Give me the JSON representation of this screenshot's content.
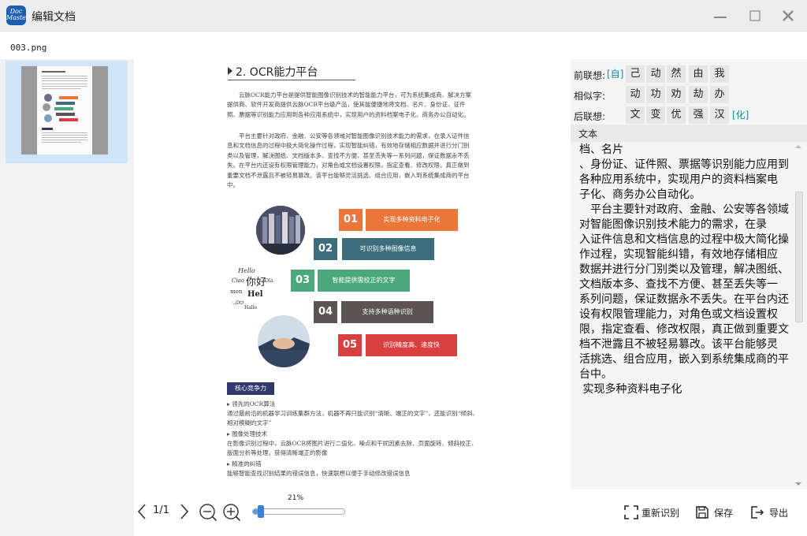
{
  "window": {
    "title": "编辑文档",
    "logo_text": "Doc Master"
  },
  "file": {
    "name": "003.png"
  },
  "document": {
    "heading": "2. OCR能力平台",
    "p1": "云脉OCR能力平台是提供智能图像识别技术的智能能力平台，可为系统集成商、解决方案提供商、软件开发商提供云脉OCR平台级产品，使其能便捷地将文档、名片、身份证、证件照、票据等识别能力应用到各种应用系统中，实现用户的资料档案电子化、商务办公自动化。",
    "p2": "平台主要针对政府、金融、公安等各领域对智能图像识别技术能力的需求，在录入证件信息和文档信息的过程中极大简化操作过程，实现智能纠错，有效地存储相应数据并进行分门别类以及管理，解决图纸、文档版本多、查找不方便、甚至丢失等一系列问题，保证数据永不丢失。在平台内还设有权限管理能力，对角色或文档设置权限，指定查看、修改权限，真正做到重要文档不泄露且不被轻易篡改。该平台能够灵活挑选、组合应用，嵌入到系统集成商的平台中。",
    "items": [
      {
        "num": "01",
        "label": "实现多种资料电子化",
        "color": "#e9773a"
      },
      {
        "num": "02",
        "label": "可识别多种图像信息",
        "color": "#3b6d7c"
      },
      {
        "num": "03",
        "label": "智能提供需校正的文字",
        "color": "#4aa87c"
      },
      {
        "num": "04",
        "label": "支持多种语种识别",
        "color": "#5a5552"
      },
      {
        "num": "05",
        "label": "识别精度高、速度快",
        "color": "#d8403f"
      }
    ],
    "section_label": "核心竞争力",
    "features": [
      {
        "title": "领先的OCR算法",
        "desc": "通过最前沿的机器学习训练集群方法，机器不再只能识别“清晰、端正的文字”，还能识别“倾斜、相对模糊的文字”"
      },
      {
        "title": "图像处理技术",
        "desc": "在影像识别过程中，云脉OCR将图片进行二值化、噪点和干扰因素去除、页面旋转、倾斜校正、版面分析等处理，获得清晰端正的影像"
      },
      {
        "title": "精准的纠错",
        "desc": "能够智能查找识别结果的错误信息，快速联想以便于手动修改错误信息"
      }
    ]
  },
  "associations": {
    "prev_label": "前联想:",
    "prev_bracket": "[自]",
    "prev_chars": [
      "己",
      "动",
      "然",
      "由",
      "我"
    ],
    "similar_label": "相似字:",
    "similar_chars": [
      "动",
      "功",
      "劝",
      "劫",
      "办"
    ],
    "next_label": "后联想:",
    "next_chars": [
      "文",
      "变",
      "优",
      "强",
      "汉"
    ],
    "next_bracket": "[化]"
  },
  "text_panel": {
    "header": "文本",
    "content": "档、名片\n、身份证、证件照、票据等识别能力应用到各种应用系统中，实现用户的资料档案电\n子化、商务办公自动化。\n　平台主要针对政府、金融、公安等各领域对智能图像识别技术能力的需求，在录\n入证件信息和文档信息的过程中极大简化操作过程，实现智能纠错，有效地存储相应\n数据并进行分门别类以及管理，解决图纸、文档版本多、查找不方便、甚至丢失等一\n系列问题，保证数据永不丢失。在平台内还设有权限管理能力，对角色或文档设置权\n限，指定查看、修改权限，真正做到重要文档不泄露且不被轻易篡改。该平台能够灵\n活挑选、组合应用，嵌入到系统集成商的平台中。\n 实现多种资料电子化"
  },
  "toolbar": {
    "page_indicator": "1/1",
    "zoom_percent": "21%",
    "zoom_fraction": 0.06,
    "recognize_label": "重新识别",
    "save_label": "保存",
    "export_label": "导出"
  }
}
